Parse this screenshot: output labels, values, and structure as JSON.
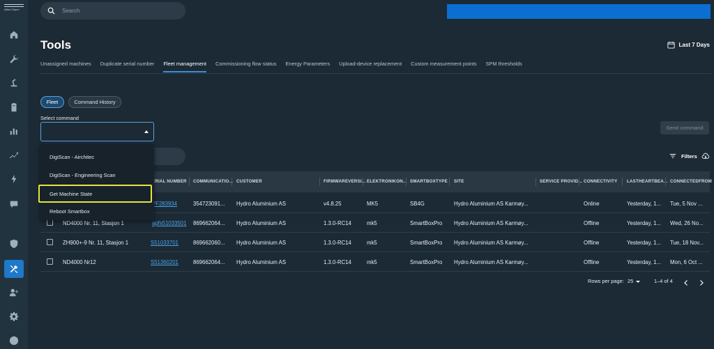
{
  "sidebar": {
    "logo_text": "Atlas Copco",
    "items": [
      {
        "icon": "home-icon"
      },
      {
        "icon": "wrench-icon"
      },
      {
        "icon": "robot-arm-icon"
      },
      {
        "icon": "clipboard-icon"
      },
      {
        "icon": "bar-chart-icon"
      },
      {
        "icon": "trend-line-icon"
      },
      {
        "icon": "lightning-icon"
      },
      {
        "icon": "message-icon"
      },
      {
        "icon": "shield-gear-icon"
      },
      {
        "icon": "tools-icon",
        "active": true
      },
      {
        "icon": "add-user-icon"
      },
      {
        "icon": "gear-icon"
      },
      {
        "icon": "help-icon"
      }
    ]
  },
  "search": {
    "placeholder": "Search"
  },
  "page": {
    "title": "Tools",
    "date_range": "Last 7 Days"
  },
  "tabs": [
    {
      "label": "Unassigned machines"
    },
    {
      "label": "Duplicate serial number"
    },
    {
      "label": "Fleet management",
      "active": true
    },
    {
      "label": "Commissioning flow status"
    },
    {
      "label": "Energy Parameters"
    },
    {
      "label": "Upload-device replacement"
    },
    {
      "label": "Custom measurement points"
    },
    {
      "label": "SPM thresholds"
    }
  ],
  "chips": {
    "fleet": "Fleet",
    "history": "Command History"
  },
  "command": {
    "label": "Select command",
    "value": "",
    "send_label": "Send command"
  },
  "dropdown": {
    "options": [
      "DigiScan - Airchitec",
      "DigiScan - Engineering Scan",
      "Get Machine State",
      "Reboot Smartbox"
    ],
    "highlighted": "Get Machine State"
  },
  "filters_label": "Filters",
  "table": {
    "columns": [
      "ERIAL NUMBER",
      "COMMUNICATIO...",
      "CUSTOMER",
      "FIRMWAREVERSI...",
      "ELEKTRONIKON...",
      "SMARTBOXTYPE",
      "SITE",
      "SERVICE PROVID...",
      "CONNECTIVITY",
      "LASTHEARTBEA...",
      "CONNECTEDFROM"
    ],
    "rows": [
      {
        "name": "",
        "serial": "PF283934",
        "comm": "354723091...",
        "customer": "Hydro Aluminium AS",
        "firmware": "v4.8.25",
        "elektronikon": "MK5",
        "smartbox": "SB4G",
        "site": "Hydro Aluminium AS Karmøy...",
        "service": "",
        "connectivity": "Online",
        "heartbeat": "Yesterday, 1...",
        "connected": "Tue, 5 Nov ..."
      },
      {
        "name": "ND4000 Nr. 11, Stasjon 1",
        "serial": "apfs51033501",
        "comm": "869662064...",
        "customer": "Hydro Aluminium AS",
        "firmware": "1.3.0-RC14",
        "elektronikon": "mk5",
        "smartbox": "SmartBoxPro",
        "site": "Hydro Aluminium AS Karmøy...",
        "service": "",
        "connectivity": "Offline",
        "heartbeat": "Yesterday, 1...",
        "connected": "Wed, 26 No..."
      },
      {
        "name": "ZH900+-9 Nr. 11, Stasjon 1",
        "serial": "S51033701",
        "comm": "869662060...",
        "customer": "Hydro Aluminium AS",
        "firmware": "1.3.0-RC14",
        "elektronikon": "mk5",
        "smartbox": "SmartBoxPro",
        "site": "Hydro Aluminium AS Karmøy...",
        "service": "",
        "connectivity": "Offline",
        "heartbeat": "Yesterday, 1...",
        "connected": "Tue, 18 Nov..."
      },
      {
        "name": "ND4000 Nr12",
        "serial": "S51360201",
        "comm": "869662064...",
        "customer": "Hydro Aluminium AS",
        "firmware": "1.3.0-RC14",
        "elektronikon": "mk5",
        "smartbox": "SmartBoxPro",
        "site": "Hydro Aluminium AS Karmøy...",
        "service": "",
        "connectivity": "Offline",
        "heartbeat": "Yesterday, 1...",
        "connected": "Mon, 6 Oct ..."
      }
    ]
  },
  "pagination": {
    "rows_per_page_label": "Rows per page:",
    "rows_per_page": "25",
    "range": "1–4 of 4"
  },
  "colors": {
    "accent": "#1f78c8",
    "link": "#4aa3e8",
    "highlight_border": "#e6e63a",
    "banner": "#0b6fd1"
  }
}
